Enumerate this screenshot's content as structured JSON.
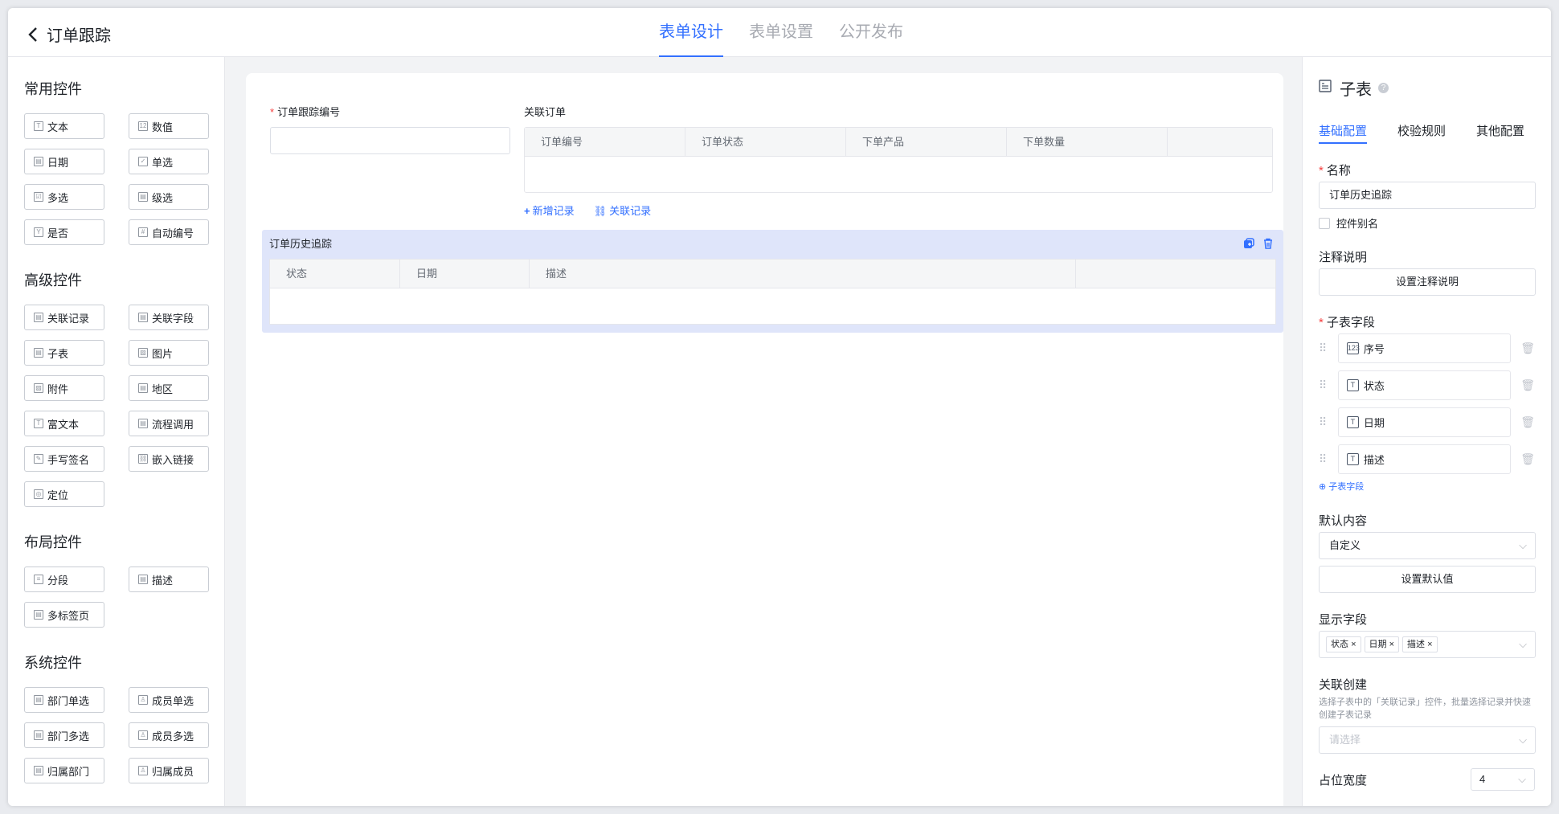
{
  "header": {
    "back_title": "订单跟踪",
    "tabs": [
      {
        "label": "表单设计",
        "active": true
      },
      {
        "label": "表单设置",
        "active": false
      },
      {
        "label": "公开发布",
        "active": false
      }
    ]
  },
  "left": {
    "groups": [
      {
        "title": "常用控件",
        "items": [
          {
            "label": "文本",
            "icon": "T"
          },
          {
            "label": "数值",
            "icon": "12"
          },
          {
            "label": "日期",
            "icon": "▤"
          },
          {
            "label": "单选",
            "icon": "✓"
          },
          {
            "label": "多选",
            "icon": "☑"
          },
          {
            "label": "级选",
            "icon": "▤"
          },
          {
            "label": "是否",
            "icon": "Y"
          },
          {
            "label": "自动编号",
            "icon": "#"
          }
        ]
      },
      {
        "title": "高级控件",
        "items": [
          {
            "label": "关联记录",
            "icon": "▤"
          },
          {
            "label": "关联字段",
            "icon": "▤"
          },
          {
            "label": "子表",
            "icon": "▤"
          },
          {
            "label": "图片",
            "icon": "▨"
          },
          {
            "label": "附件",
            "icon": "▨"
          },
          {
            "label": "地区",
            "icon": "▤"
          },
          {
            "label": "富文本",
            "icon": "T"
          },
          {
            "label": "流程调用",
            "icon": "▤"
          },
          {
            "label": "手写签名",
            "icon": "✎"
          },
          {
            "label": "嵌入链接",
            "icon": "⛓"
          },
          {
            "label": "定位",
            "icon": "◎"
          }
        ]
      },
      {
        "title": "布局控件",
        "items": [
          {
            "label": "分段",
            "icon": "≡"
          },
          {
            "label": "描述",
            "icon": "▤"
          },
          {
            "label": "多标签页",
            "icon": "▤"
          }
        ]
      },
      {
        "title": "系统控件",
        "items": [
          {
            "label": "部门单选",
            "icon": "▤"
          },
          {
            "label": "成员单选",
            "icon": "♙"
          },
          {
            "label": "部门多选",
            "icon": "▤"
          },
          {
            "label": "成员多选",
            "icon": "♙"
          },
          {
            "label": "归属部门",
            "icon": "▤"
          },
          {
            "label": "归属成员",
            "icon": "♙"
          }
        ]
      }
    ]
  },
  "canvas": {
    "field1_label": "订单跟踪编号",
    "field2_label": "关联订单",
    "rel_columns": [
      "订单编号",
      "订单状态",
      "下单产品",
      "下单数量"
    ],
    "add_record": "新增记录",
    "link_record": "关联记录",
    "sub_title": "订单历史追踪",
    "sub_columns": [
      "状态",
      "日期",
      "描述"
    ]
  },
  "right": {
    "title": "子表",
    "tabs": [
      "基础配置",
      "校验规则",
      "其他配置"
    ],
    "name_label": "名称",
    "name_value": "订单历史追踪",
    "alias_label": "控件别名",
    "note_label": "注释说明",
    "note_button": "设置注释说明",
    "subfields_label": "子表字段",
    "subfields": [
      {
        "label": "序号",
        "icon": "123"
      },
      {
        "label": "状态",
        "icon": "T"
      },
      {
        "label": "日期",
        "icon": "T"
      },
      {
        "label": "描述",
        "icon": "T"
      }
    ],
    "add_subfield": "子表字段",
    "default_label": "默认内容",
    "default_value": "自定义",
    "default_button": "设置默认值",
    "display_label": "显示字段",
    "display_tags": [
      "状态",
      "日期",
      "描述"
    ],
    "link_create_label": "关联创建",
    "link_create_hint": "选择子表中的「关联记录」控件，批量选择记录并快速创建子表记录",
    "link_create_placeholder": "请选择",
    "width_label": "占位宽度",
    "width_value": "4"
  }
}
